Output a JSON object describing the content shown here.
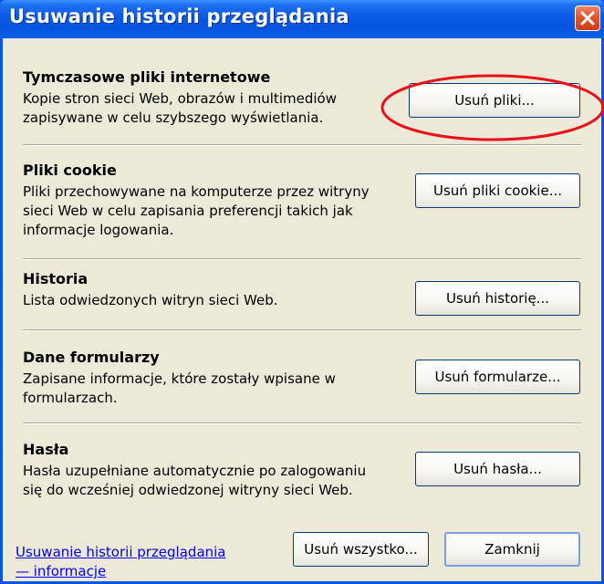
{
  "window": {
    "title": "Usuwanie historii przeglądania"
  },
  "sections": [
    {
      "title": "Tymczasowe pliki internetowe",
      "description": "Kopie stron sieci Web, obrazów i multimediów zapisywane w celu szybszego wyświetlania.",
      "button": "Usuń pliki..."
    },
    {
      "title": "Pliki cookie",
      "description": "Pliki przechowywane na komputerze przez witryny sieci Web w celu zapisania preferencji takich jak informacje logowania.",
      "button": "Usuń pliki cookie..."
    },
    {
      "title": "Historia",
      "description": "Lista odwiedzonych witryn sieci Web.",
      "button": "Usuń historię..."
    },
    {
      "title": "Dane formularzy",
      "description": "Zapisane informacje, które zostały wpisane w formularzach.",
      "button": "Usuń formularze..."
    },
    {
      "title": "Hasła",
      "description": "Hasła uzupełniane automatycznie po zalogowaniu się do wcześniej odwiedzonej witryny sieci Web.",
      "button": "Usuń hasła..."
    }
  ],
  "footer": {
    "help_link_line1": "Usuwanie historii przeglądania",
    "help_link_line2": "— informacje",
    "delete_all_button": "Usuń wszystko...",
    "close_button": "Zamknij"
  },
  "icons": {
    "close": "close-icon"
  },
  "colors": {
    "titlebar": "#0a5ae6",
    "dialog_background": "#ece9d8",
    "close_button": "#e4532a",
    "highlight_annotation": "#e8121b",
    "link": "#0000ee"
  }
}
